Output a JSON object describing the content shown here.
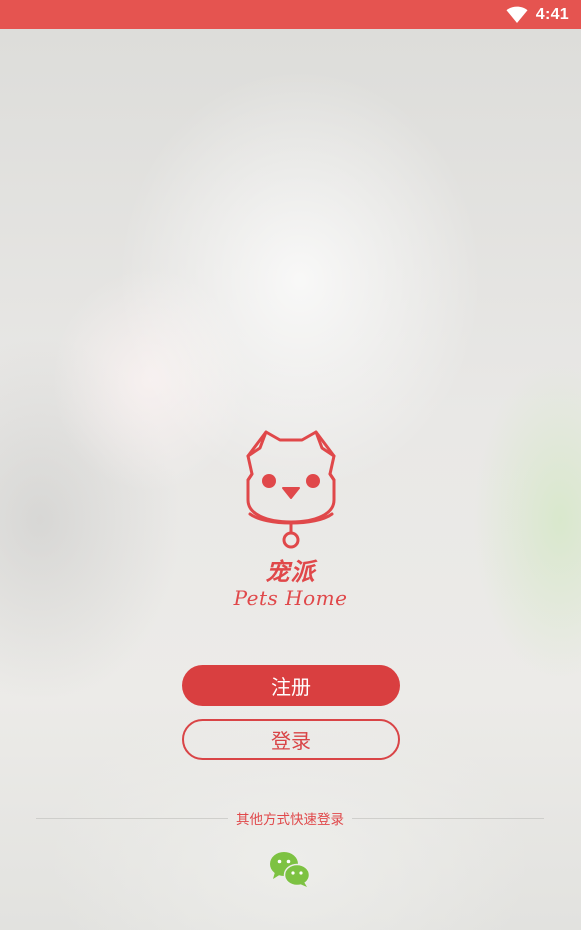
{
  "status_bar": {
    "time": "4:41",
    "wifi_icon": "wifi-icon",
    "background_color": "#e55450"
  },
  "brand": {
    "logo_icon": "dog-logo-icon",
    "name_cn": "宠派",
    "name_en": "Pets Home",
    "color": "#e0484a"
  },
  "actions": {
    "register_label": "注册",
    "login_label": "登录"
  },
  "quick_login": {
    "label": "其他方式快速登录",
    "wechat_icon": "wechat-icon",
    "wechat_color": "#7dc242"
  }
}
